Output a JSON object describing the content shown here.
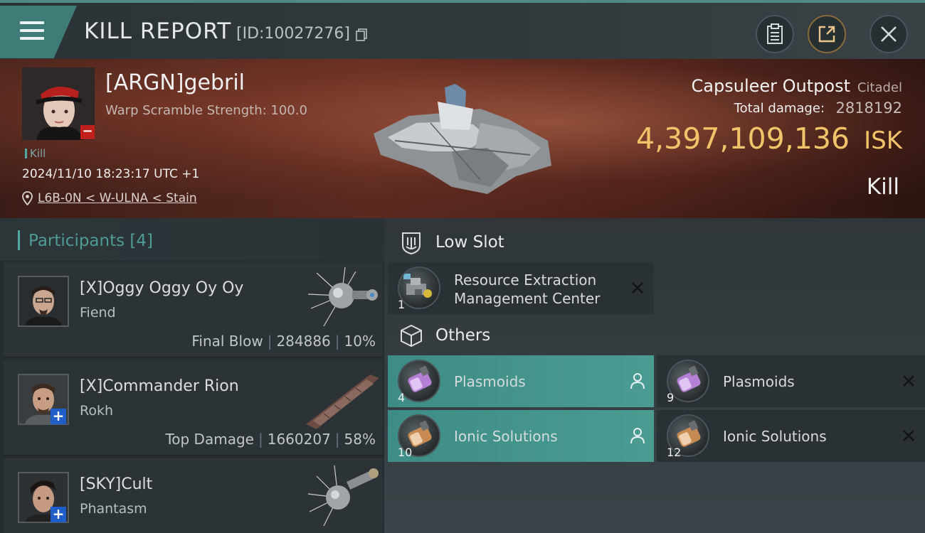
{
  "header": {
    "title": "KILL REPORT",
    "report_id": "[ID:10027276]"
  },
  "victim": {
    "name": "[ARGN]gebril",
    "scramble": "Warp Scramble Strength: 100.0",
    "tag": "Kill",
    "datetime": "2024/11/10 18:23:17 UTC +1",
    "location": "L6B-0N < W-ULNA < Stain"
  },
  "target": {
    "name": "Capsuleer Outpost",
    "type": "Citadel",
    "total_damage_label": "Total damage:",
    "total_damage": "2818192",
    "isk_value": "4,397,109,136",
    "isk_unit": "ISK",
    "result": "Kill"
  },
  "participants": {
    "title": "Participants",
    "count": "[4]",
    "rows": [
      {
        "name": "[X]Oggy Oggy Oy Oy",
        "ship": "Fiend",
        "role": "Final Blow",
        "damage": "284886",
        "percent": "10%"
      },
      {
        "name": "[X]Commander Rion",
        "ship": "Rokh",
        "role": "Top Damage",
        "damage": "1660207",
        "percent": "58%"
      },
      {
        "name": "[SKY]Cult",
        "ship": "Phantasm"
      }
    ]
  },
  "low_slot": {
    "title": "Low Slot",
    "items": [
      {
        "name_line1": "Resource Extraction",
        "name_line2": "Management Center",
        "qty": "1"
      }
    ]
  },
  "others": {
    "title": "Others",
    "items": [
      {
        "name": "Plasmoids",
        "qty": "4",
        "state": "dropped"
      },
      {
        "name": "Plasmoids",
        "qty": "9",
        "state": "destroyed"
      },
      {
        "name": "Ionic Solutions",
        "qty": "10",
        "state": "dropped"
      },
      {
        "name": "Ionic Solutions",
        "qty": "12",
        "state": "destroyed"
      }
    ]
  },
  "colors": {
    "accent": "#4fa9a2",
    "isk": "#f2c46a",
    "dropped_bg": "#4a9c93"
  }
}
